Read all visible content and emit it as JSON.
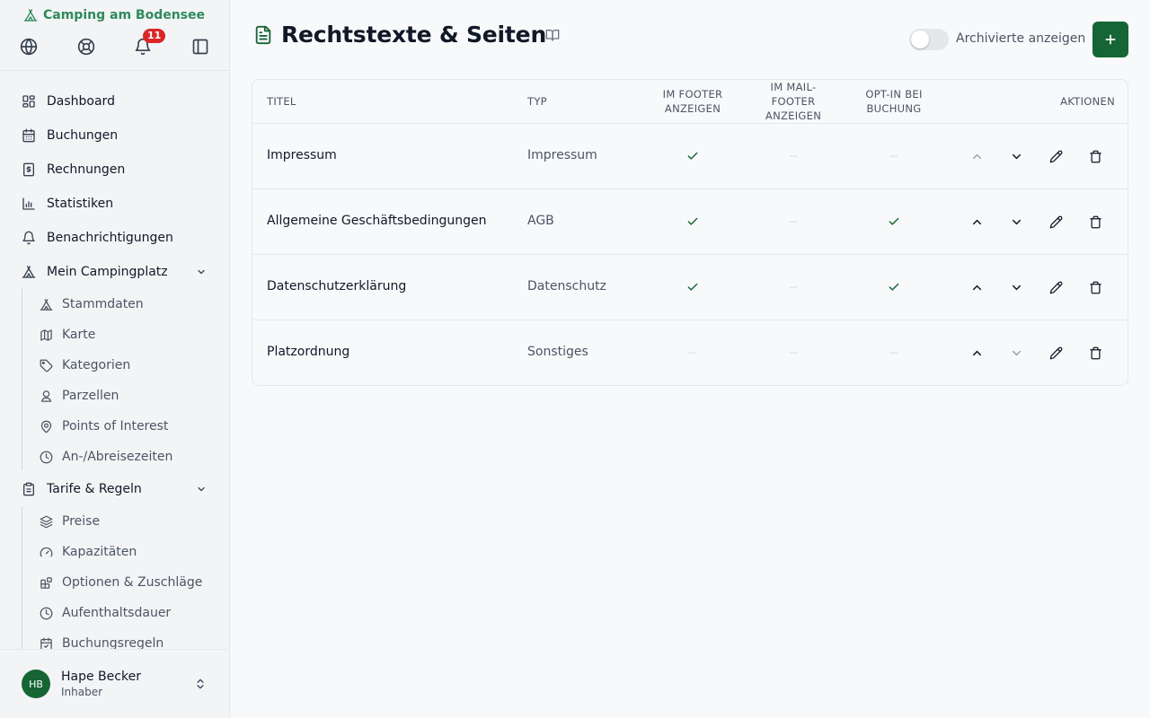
{
  "sidebar": {
    "brand": "Camping am Bodensee",
    "notification_count": "11",
    "items": [
      {
        "label": "Dashboard",
        "icon": "dashboard-icon"
      },
      {
        "label": "Buchungen",
        "icon": "calendar-icon"
      },
      {
        "label": "Rechnungen",
        "icon": "invoice-icon"
      },
      {
        "label": "Statistiken",
        "icon": "chart-icon"
      },
      {
        "label": "Benachrichtigungen",
        "icon": "bell-icon"
      },
      {
        "label": "Mein Campingplatz",
        "icon": "tent-icon",
        "expanded": true
      },
      {
        "label": "Tarife & Regeln",
        "icon": "clipboard-icon",
        "expanded": true
      }
    ],
    "campingplatz_sub": [
      {
        "label": "Stammdaten",
        "icon": "tent-icon"
      },
      {
        "label": "Karte",
        "icon": "map-icon"
      },
      {
        "label": "Kategorien",
        "icon": "tag-icon"
      },
      {
        "label": "Parzellen",
        "icon": "pin-user-icon"
      },
      {
        "label": "Points of Interest",
        "icon": "map-pin-icon"
      },
      {
        "label": "An-/Abreisezeiten",
        "icon": "clock-icon"
      }
    ],
    "tarife_sub": [
      {
        "label": "Preise",
        "icon": "layers-icon"
      },
      {
        "label": "Kapazitäten",
        "icon": "gauge-icon"
      },
      {
        "label": "Optionen & Zuschläge",
        "icon": "blocks-icon"
      },
      {
        "label": "Aufenthaltsdauer",
        "icon": "clock-icon"
      },
      {
        "label": "Buchungsregeln",
        "icon": "calendar-check-icon"
      }
    ],
    "user": {
      "initials": "HB",
      "name": "Hape Becker",
      "role": "Inhaber"
    }
  },
  "header": {
    "title": "Rechtstexte & Seiten",
    "toggle_label": "Archivierte anzeigen",
    "toggle_on": false
  },
  "table": {
    "columns": {
      "title": "Titel",
      "type": "Typ",
      "footer": "Im Footer anzeigen",
      "mailfooter": "Im Mail-Footer anzeigen",
      "optin": "Opt-in bei Buchung",
      "actions": "Aktionen"
    },
    "rows": [
      {
        "title": "Impressum",
        "type": "Impressum",
        "footer": true,
        "mailfooter": false,
        "optin": false,
        "up_enabled": false,
        "down_enabled": true
      },
      {
        "title": "Allgemeine Geschäftsbedingungen",
        "type": "AGB",
        "footer": true,
        "mailfooter": false,
        "optin": true,
        "up_enabled": true,
        "down_enabled": true
      },
      {
        "title": "Datenschutzerklärung",
        "type": "Datenschutz",
        "footer": true,
        "mailfooter": false,
        "optin": true,
        "up_enabled": true,
        "down_enabled": true
      },
      {
        "title": "Platzordnung",
        "type": "Sonstiges",
        "footer": false,
        "mailfooter": false,
        "optin": false,
        "up_enabled": true,
        "down_enabled": false
      }
    ]
  },
  "colors": {
    "accent": "#166534",
    "brand_text": "#2f8a5a",
    "badge": "#dc2626"
  }
}
